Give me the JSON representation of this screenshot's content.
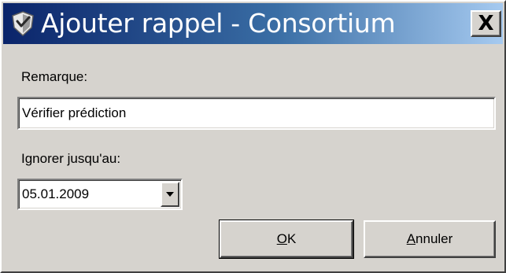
{
  "window": {
    "title": "Ajouter rappel - Consortium",
    "close_label": "X",
    "title_gradient": [
      "#0a246a",
      "#3a6ea5",
      "#a6caf0"
    ],
    "background": "#d6d3ce",
    "app_icon": "shield-icon"
  },
  "form": {
    "remark": {
      "label": "Remarque:",
      "value": "Vérifier prédiction"
    },
    "ignore_until": {
      "label": "Ignorer jusqu'au:",
      "value": "05.01.2009",
      "dropdown_icon": "chevron-down-icon"
    }
  },
  "buttons": {
    "ok": {
      "mnemonic": "O",
      "rest": "K"
    },
    "cancel": {
      "mnemonic": "A",
      "rest": "nnuler"
    }
  }
}
